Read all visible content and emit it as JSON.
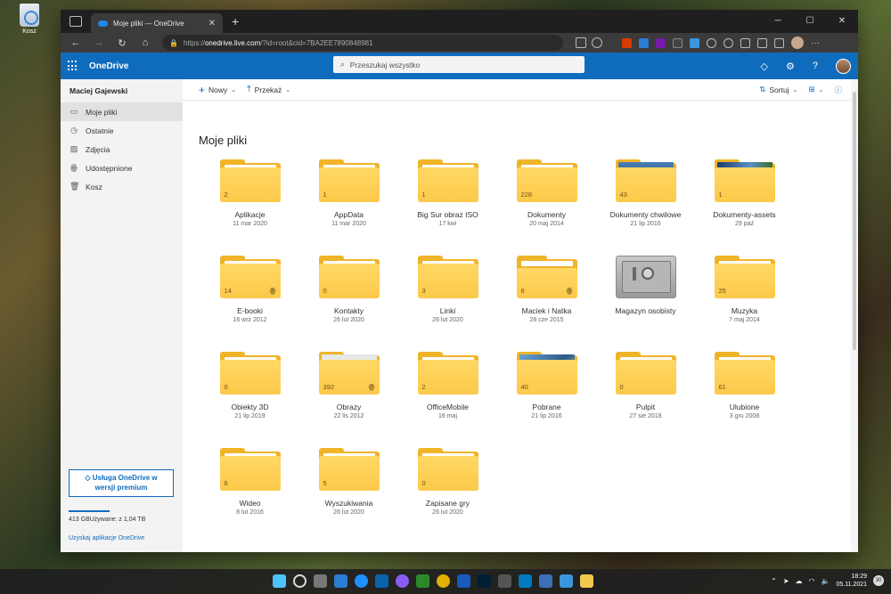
{
  "desktop": {
    "recycle_bin_label": "Kosz"
  },
  "browser": {
    "tab_title": "Moje pliki — OneDrive",
    "url_prefix": "https://",
    "url_host": "onedrive.live.com",
    "url_rest": "/?id=root&cid=7BA2EE7890848981"
  },
  "header": {
    "brand": "OneDrive",
    "search_placeholder": "Przeszukaj wszystko",
    "help_glyph": "?"
  },
  "sidebar": {
    "user": "Maciej Gajewski",
    "items": [
      {
        "label": "Moje pliki",
        "icon": "folder-icon",
        "active": true
      },
      {
        "label": "Ostatnie",
        "icon": "history-icon",
        "active": false
      },
      {
        "label": "Zdjęcia",
        "icon": "image-icon",
        "active": false
      },
      {
        "label": "Udostępnione",
        "icon": "people-icon",
        "active": false
      },
      {
        "label": "Kosz",
        "icon": "trash-icon",
        "active": false
      }
    ],
    "premium_label": "Usługa OneDrive w wersji premium",
    "storage_text": "413 GBUżywane: z 1,04 TB",
    "get_app": "Uzyskaj aplikacje OneDrive"
  },
  "toolbar": {
    "new_label": "Nowy",
    "upload_label": "Przekaż",
    "sort_label": "Sortuj"
  },
  "main": {
    "title": "Moje pliki",
    "items": [
      {
        "name": "Aplikacje",
        "date": "11 mar 2020",
        "count": "2",
        "kind": "folder"
      },
      {
        "name": "AppData",
        "date": "11 mar 2020",
        "count": "1",
        "kind": "folder"
      },
      {
        "name": "Big Sur obraz ISO",
        "date": "17 kwi",
        "count": "1",
        "kind": "folder"
      },
      {
        "name": "Dokumenty",
        "date": "20 maj 2014",
        "count": "228",
        "kind": "folder"
      },
      {
        "name": "Dokumenty chwilowe",
        "date": "21 lip 2016",
        "count": "43",
        "kind": "thumb"
      },
      {
        "name": "Dokumenty-assets",
        "date": "29 paź",
        "count": "1",
        "kind": "thumb"
      },
      {
        "name": "E-booki",
        "date": "16 wrz 2012",
        "count": "14",
        "kind": "shared"
      },
      {
        "name": "Kontakty",
        "date": "26 lut 2020",
        "count": "0",
        "kind": "folder"
      },
      {
        "name": "Linki",
        "date": "26 lut 2020",
        "count": "3",
        "kind": "folder"
      },
      {
        "name": "Maciek i Natka",
        "date": "28 cze 2015",
        "count": "6",
        "kind": "shared-open"
      },
      {
        "name": "Magazyn osobisty",
        "date": "",
        "count": "",
        "kind": "vault"
      },
      {
        "name": "Muzyka",
        "date": "7 maj 2014",
        "count": "25",
        "kind": "folder"
      },
      {
        "name": "Obiekty 3D",
        "date": "21 lip 2019",
        "count": "0",
        "kind": "folder"
      },
      {
        "name": "Obrazy",
        "date": "22 lis 2012",
        "count": "392",
        "kind": "thumb-shared"
      },
      {
        "name": "OfficeMobile",
        "date": "16 maj",
        "count": "2",
        "kind": "folder"
      },
      {
        "name": "Pobrane",
        "date": "21 lip 2016",
        "count": "40",
        "kind": "thumb"
      },
      {
        "name": "Pulpit",
        "date": "27 sie 2018",
        "count": "0",
        "kind": "folder"
      },
      {
        "name": "Ulubione",
        "date": "3 gru 2008",
        "count": "61",
        "kind": "folder"
      },
      {
        "name": "Wideo",
        "date": "8 lut 2016",
        "count": "6",
        "kind": "folder"
      },
      {
        "name": "Wyszukiwania",
        "date": "26 lut 2020",
        "count": "5",
        "kind": "folder"
      },
      {
        "name": "Zapisane gry",
        "date": "26 lut 2020",
        "count": "0",
        "kind": "folder"
      }
    ]
  },
  "taskbar": {
    "time": "18:29",
    "date": "05.11.2021",
    "notifications": "30"
  },
  "colors": {
    "brand_blue": "#0f6cbd",
    "folder_yellow": "#fcc94a"
  }
}
